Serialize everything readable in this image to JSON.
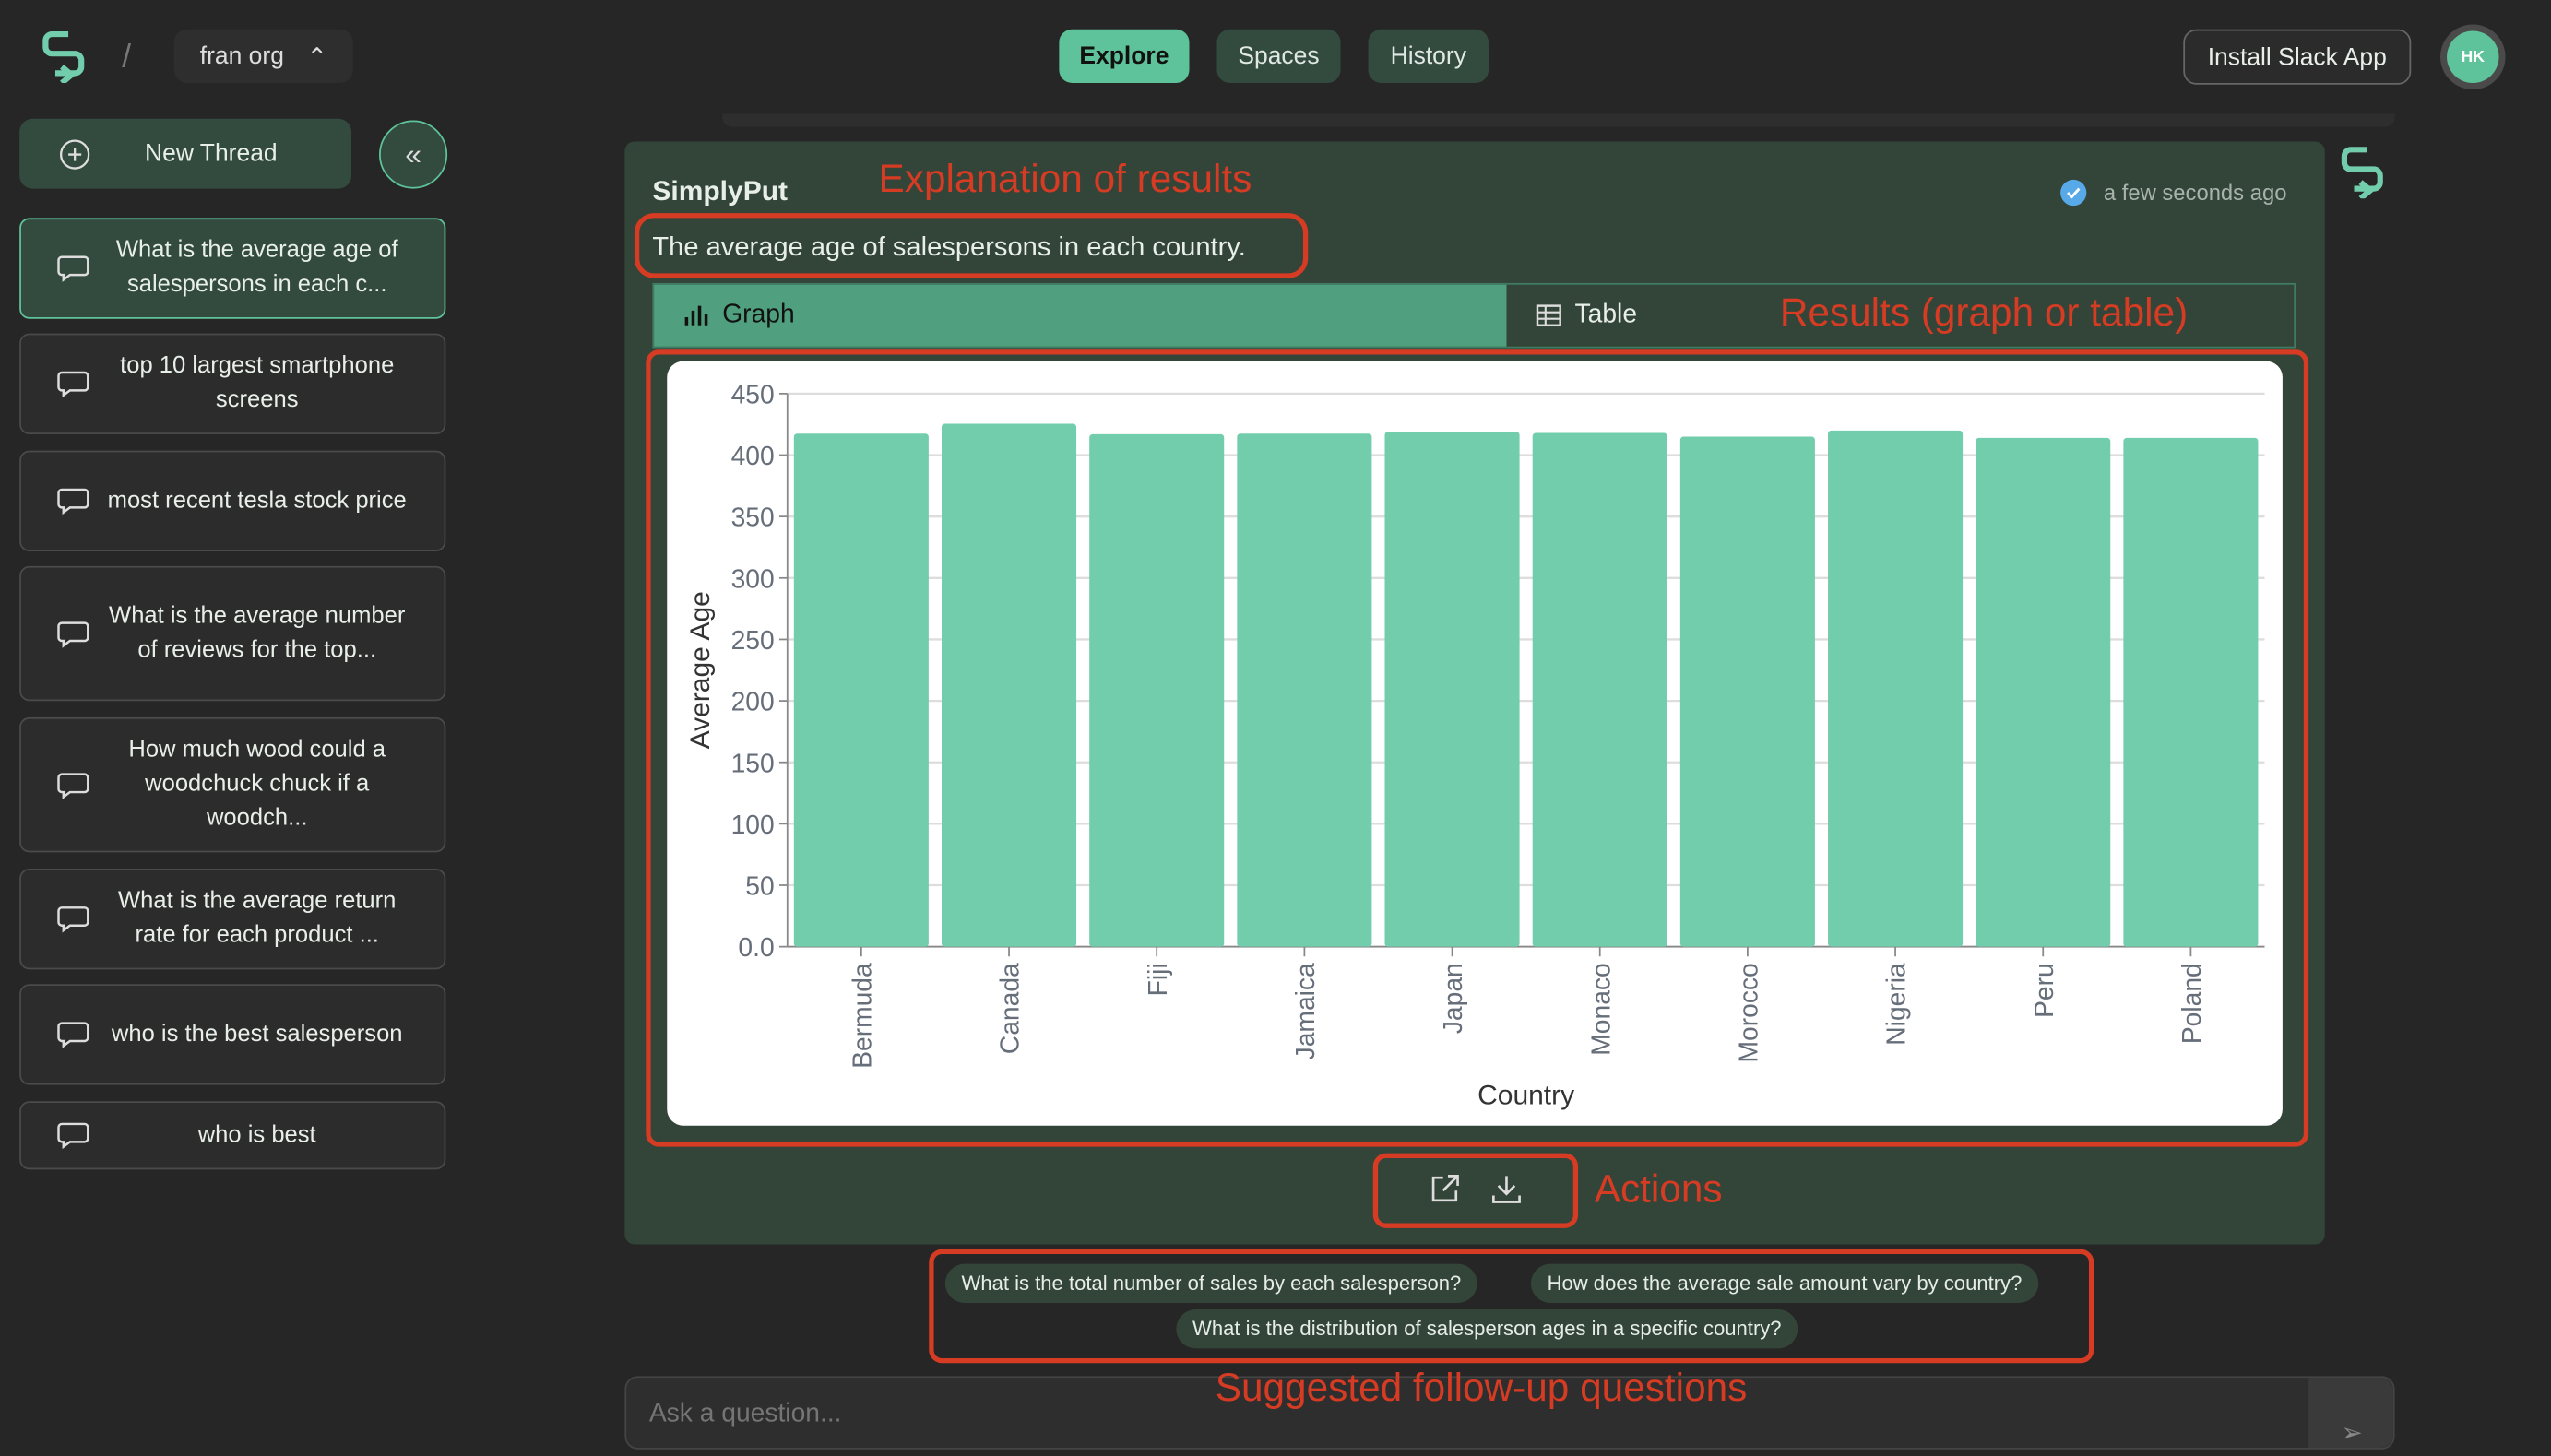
{
  "header": {
    "org": "fran org",
    "nav": [
      {
        "label": "Explore",
        "active": true
      },
      {
        "label": "Spaces"
      },
      {
        "label": "History"
      }
    ],
    "install_slack": "Install Slack App",
    "avatar_initials": "HK"
  },
  "sidebar": {
    "new_thread": "New Thread",
    "threads": [
      {
        "label": "What is the average age of salespersons in each c...",
        "active": true
      },
      {
        "label": "top 10 largest smartphone screens"
      },
      {
        "label": "most recent tesla stock price"
      },
      {
        "label": "What is the average number of reviews for the top..."
      },
      {
        "label": "How much wood could a woodchuck chuck if a woodch..."
      },
      {
        "label": "What is the average return rate for each product ..."
      },
      {
        "label": "who is the best salesperson"
      },
      {
        "label": "who is best"
      }
    ]
  },
  "result": {
    "author": "SimplyPut",
    "timestamp": "a few seconds ago",
    "explanation": "The average age of salespersons in each country.",
    "tabs": {
      "graph": "Graph",
      "table": "Table"
    }
  },
  "annotations": {
    "explanation": "Explanation of results",
    "results": "Results (graph or table)",
    "actions": "Actions",
    "followups": "Suggested follow-up questions"
  },
  "followups": [
    "What is the total number of sales by each salesperson?",
    "How does the average sale amount vary by country?",
    "What is the distribution of salesperson ages in a specific country?"
  ],
  "input": {
    "placeholder": "Ask a question..."
  },
  "colors": {
    "accent": "#5ec39a",
    "bar": "#72cdad",
    "annotation": "#d63b23"
  },
  "chart_data": {
    "type": "bar",
    "xlabel": "Country",
    "ylabel": "Average Age",
    "ylim": [
      0,
      450
    ],
    "yticks": [
      "0.0",
      "50",
      "100",
      "150",
      "200",
      "250",
      "300",
      "350",
      "400",
      "450"
    ],
    "categories": [
      "Bermuda",
      "Canada",
      "Fiji",
      "Jamaica",
      "Japan",
      "Monaco",
      "Morocco",
      "Nigeria",
      "Peru",
      "Poland"
    ],
    "values": [
      417.5,
      425.5,
      417,
      417.5,
      419,
      418,
      415,
      420,
      414,
      414
    ],
    "grid": true
  }
}
